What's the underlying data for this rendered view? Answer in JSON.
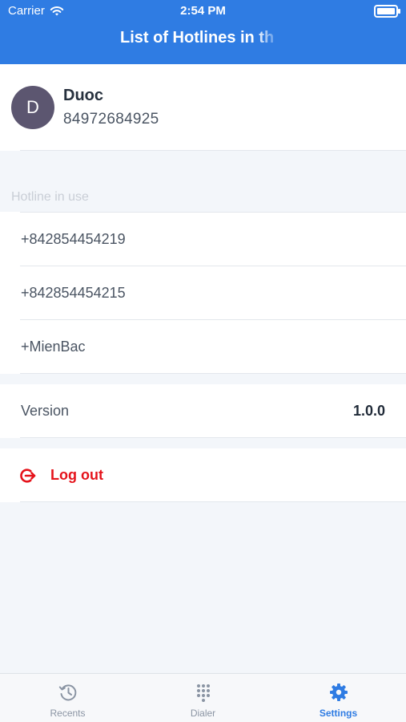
{
  "status_bar": {
    "carrier": "Carrier",
    "time": "2:54 PM"
  },
  "header": {
    "title": "List of Hotlines in th"
  },
  "profile": {
    "initial": "D",
    "name": "Duoc",
    "phone": "84972684925"
  },
  "hotlines": {
    "section_label": "Hotline in use",
    "items": [
      "+842854454219",
      "+842854454215",
      "+MienBac"
    ]
  },
  "version": {
    "label": "Version",
    "value": "1.0.0"
  },
  "logout": {
    "label": "Log out"
  },
  "tabbar": {
    "tabs": [
      {
        "label": "Recents",
        "icon": "history-icon",
        "active": false
      },
      {
        "label": "Dialer",
        "icon": "dialpad-icon",
        "active": false
      },
      {
        "label": "Settings",
        "icon": "gear-icon",
        "active": true
      }
    ]
  },
  "colors": {
    "accent": "#2f7ce3",
    "danger": "#e5131b",
    "avatar": "#5c5670"
  }
}
